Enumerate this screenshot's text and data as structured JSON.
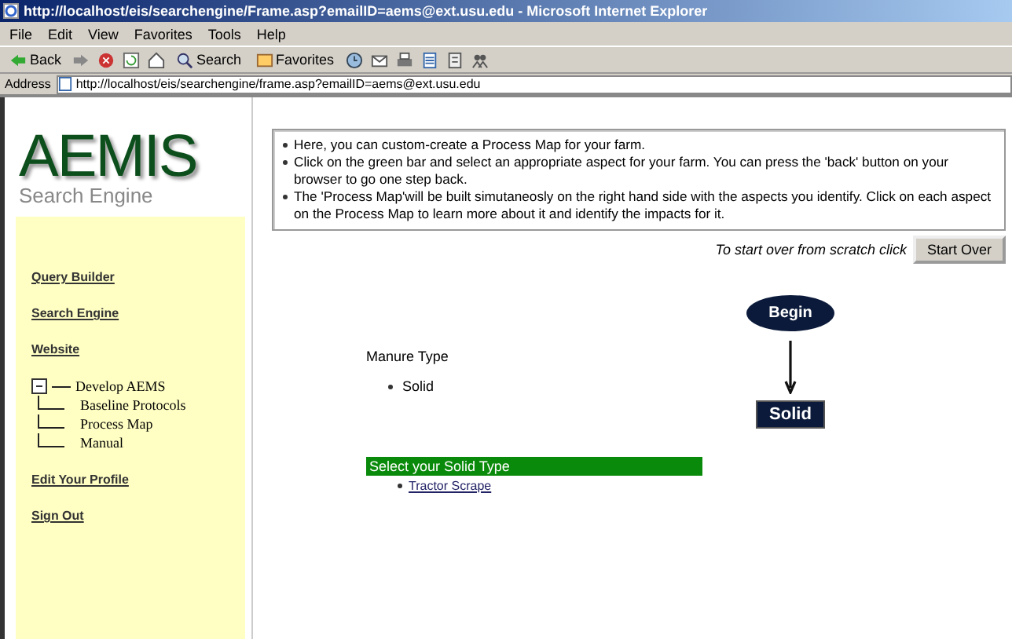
{
  "window": {
    "title": "http://localhost/eis/searchengine/Frame.asp?emailID=aems@ext.usu.edu - Microsoft Internet Explorer"
  },
  "menu": [
    "File",
    "Edit",
    "View",
    "Favorites",
    "Tools",
    "Help"
  ],
  "toolbar": [
    {
      "kind": "back",
      "label": "Back"
    },
    {
      "kind": "forward"
    },
    {
      "kind": "stop"
    },
    {
      "kind": "refresh"
    },
    {
      "kind": "home"
    },
    {
      "kind": "search",
      "label": "Search"
    },
    {
      "kind": "favorites",
      "label": "Favorites"
    },
    {
      "kind": "history"
    },
    {
      "kind": "mail"
    },
    {
      "kind": "print"
    },
    {
      "kind": "edit"
    },
    {
      "kind": "discuss"
    },
    {
      "kind": "messenger"
    }
  ],
  "address": {
    "label": "Address",
    "url": "http://localhost/eis/searchengine/frame.asp?emailID=aems@ext.usu.edu"
  },
  "logo": {
    "title": "AEMIS",
    "subtitle": "Search Engine"
  },
  "sidebar": [
    {
      "kind": "link",
      "label": "Query Builder"
    },
    {
      "kind": "link",
      "label": "Search Engine"
    },
    {
      "kind": "link",
      "label": "Website"
    },
    {
      "kind": "tree",
      "label": "Develop AEMS",
      "expanded": true,
      "children": [
        {
          "label": "Baseline Protocols"
        },
        {
          "label": "Process Map"
        },
        {
          "label": "Manual"
        }
      ]
    },
    {
      "kind": "link",
      "label": "Edit Your Profile"
    },
    {
      "kind": "link",
      "label": "Sign Out"
    }
  ],
  "instructions": [
    "Here, you can custom-create a Process Map for your farm.",
    "Click on the green bar and select an appropriate aspect for your farm. You can press the 'back' button on your browser to go one step back.",
    "The 'Process Map'will be built simutaneosly on the right hand side with the aspects you identify. Click on each aspect on the Process Map to learn more about it and identify the impacts for it."
  ],
  "start_over": {
    "prompt": "To start over from scratch click",
    "button": "Start Over"
  },
  "manure": {
    "heading": "Manure Type",
    "items": [
      "Solid"
    ]
  },
  "select_bar": {
    "label": "Select your Solid Type",
    "options": [
      "Tractor Scrape"
    ]
  },
  "process_map": [
    {
      "kind": "oval",
      "label": "Begin"
    },
    {
      "kind": "rect",
      "label": "Solid"
    }
  ]
}
